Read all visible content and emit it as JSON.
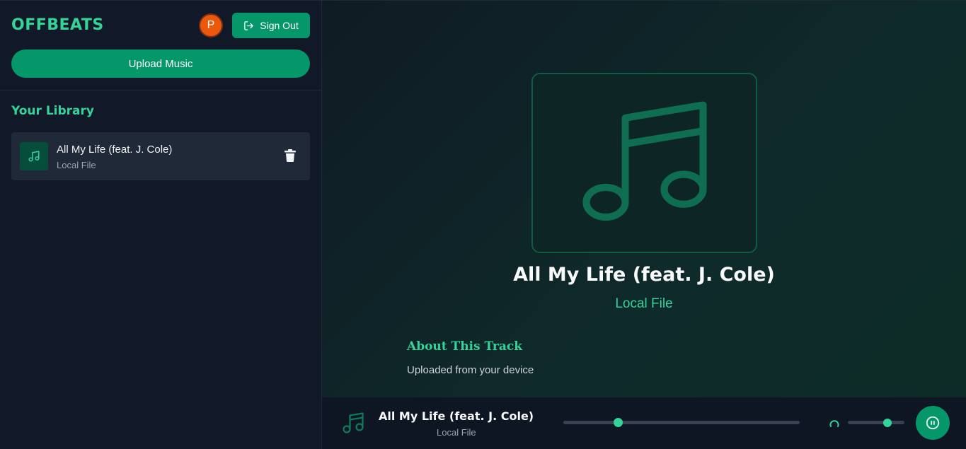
{
  "app": {
    "logo": "OFFBEATS"
  },
  "header": {
    "avatar_initial": "P",
    "signout_label": "Sign Out",
    "upload_label": "Upload Music"
  },
  "library": {
    "title": "Your Library",
    "items": [
      {
        "title": "All My Life (feat. J. Cole)",
        "subtitle": "Local File"
      }
    ]
  },
  "now_playing": {
    "title": "All My Life (feat. J. Cole)",
    "subtitle": "Local File",
    "about_heading": "About This Track",
    "about_text": "Uploaded from your device"
  },
  "player": {
    "title": "All My Life (feat. J. Cole)",
    "subtitle": "Local File",
    "progress_fraction": 0.23,
    "volume_fraction": 0.7,
    "state": "playing"
  },
  "colors": {
    "accent": "#34d399",
    "button": "#059669",
    "avatar": "#ea580c"
  },
  "icons": [
    "music-note-icon",
    "sign-out-icon",
    "trash-icon",
    "volume-icon",
    "pause-icon"
  ]
}
